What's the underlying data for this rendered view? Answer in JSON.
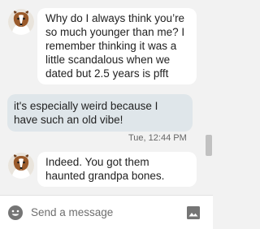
{
  "messages": [
    {
      "direction": "incoming",
      "avatar_icon": "sheltie-dog-avatar-icon",
      "text": "Why do I always think you’re so much younger than me? I remember thinking it was a little scandalous when we dated but 2.5 years is pfft"
    },
    {
      "direction": "outgoing",
      "text": "it's especially weird because I have such an old vibe!"
    },
    {
      "direction": "incoming",
      "avatar_icon": "sheltie-dog-avatar-icon",
      "text": "Indeed. You got them haunted grandpa bones."
    }
  ],
  "timestamp": "Tue, 12:44 PM",
  "composer": {
    "placeholder": "Send a message",
    "emoji_icon": "smiley-face-icon",
    "image_icon": "image-icon"
  },
  "colors": {
    "background": "#f2f2f2",
    "incoming_bubble": "#ffffff",
    "outgoing_bubble": "#dfe6ea",
    "icon_gray": "#757575"
  }
}
